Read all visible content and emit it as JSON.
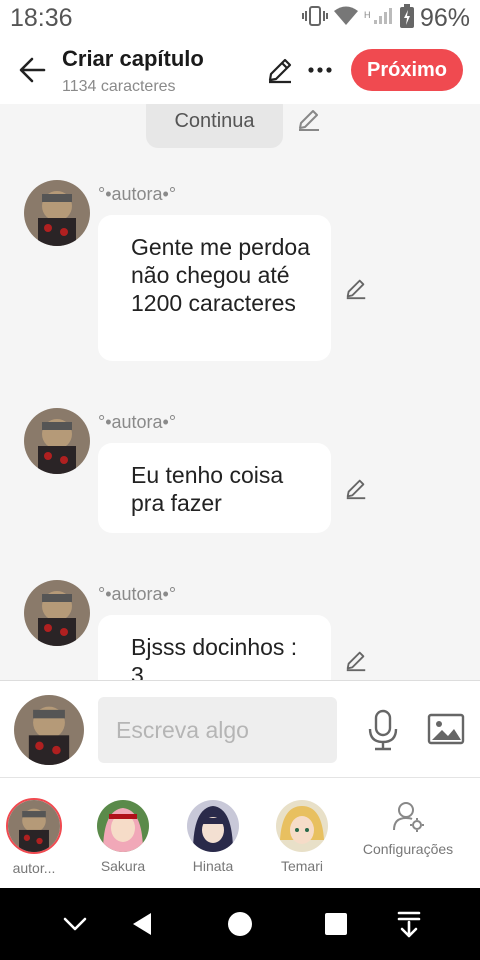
{
  "status": {
    "time": "18:36",
    "battery": "96%"
  },
  "header": {
    "title": "Criar capítulo",
    "subtitle": "1134 caracteres",
    "next_label": "Próximo"
  },
  "chat": {
    "continua": "Continua",
    "messages": [
      {
        "author": "°•autora•°",
        "text": "Gente me perdoa não chegou até 1200 caracteres"
      },
      {
        "author": "°•autora•°",
        "text": "Eu tenho coisa pra fazer"
      },
      {
        "author": "°•autora•°",
        "text": "Bjsss docinhos : 3"
      }
    ]
  },
  "composer": {
    "placeholder": "Escreva algo"
  },
  "characters": [
    {
      "name": "autor...",
      "selected": true
    },
    {
      "name": "Sakura"
    },
    {
      "name": "Hinata"
    },
    {
      "name": "Temari"
    }
  ],
  "settings_label": "Configurações",
  "colors": {
    "accent": "#f04a50",
    "bubble": "#ffffff",
    "background": "#f5f5f5"
  }
}
